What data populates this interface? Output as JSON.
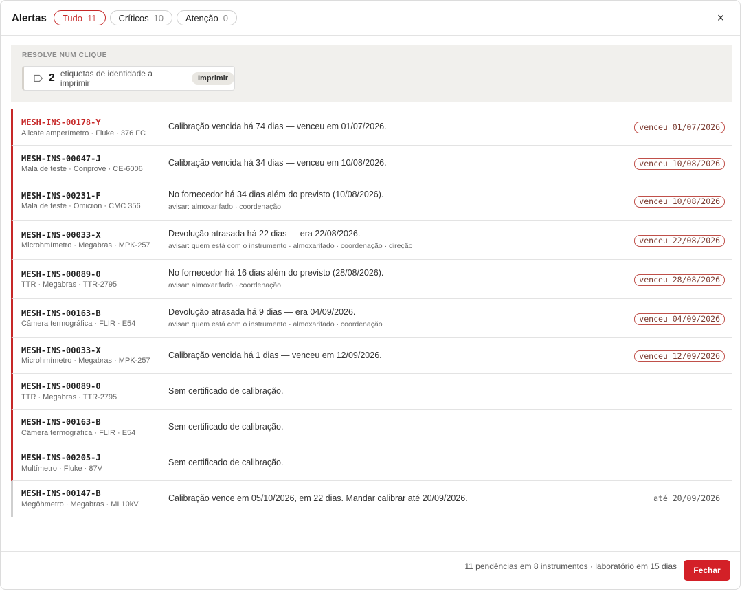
{
  "header": {
    "title": "Alertas",
    "tabs": [
      {
        "label": "Tudo",
        "count": "11",
        "active": true
      },
      {
        "label": "Críticos",
        "count": "10",
        "active": false
      },
      {
        "label": "Atenção",
        "count": "0",
        "active": false
      }
    ],
    "close": "×"
  },
  "quick": {
    "title": "RESOLVE NUM CLIQUE",
    "count": "2",
    "text": "etiquetas de identidade a imprimir",
    "button": "Imprimir"
  },
  "rows": [
    {
      "code": "MESH-INS-00178-Y",
      "sub": "Alicate amperímetro · Fluke · 376 FC",
      "msg": "Calibração vencida há 74 dias — venceu em 01/07/2026.",
      "note": "",
      "badge": "venceu 01/07/2026"
    },
    {
      "code": "MESH-INS-00047-J",
      "sub": "Mala de teste · Conprove · CE-6006",
      "msg": "Calibração vencida há 34 dias — venceu em 10/08/2026.",
      "note": "",
      "badge": "venceu 10/08/2026"
    },
    {
      "code": "MESH-INS-00231-F",
      "sub": "Mala de teste · Omicron · CMC 356",
      "msg": "No fornecedor há 34 dias além do previsto (10/08/2026).",
      "note": "avisar: almoxarifado · coordenação",
      "badge": "venceu 10/08/2026"
    },
    {
      "code": "MESH-INS-00033-X",
      "sub": "Microhmímetro · Megabras · MPK-257",
      "msg": "Devolução atrasada há 22 dias — era 22/08/2026.",
      "note": "avisar: quem está com o instrumento · almoxarifado · coordenação · direção",
      "badge": "venceu 22/08/2026"
    },
    {
      "code": "MESH-INS-00089-0",
      "sub": "TTR · Megabras · TTR-2795",
      "msg": "No fornecedor há 16 dias além do previsto (28/08/2026).",
      "note": "avisar: almoxarifado · coordenação",
      "badge": "venceu 28/08/2026"
    },
    {
      "code": "MESH-INS-00163-B",
      "sub": "Câmera termográfica · FLIR · E54",
      "msg": "Devolução atrasada há 9 dias — era 04/09/2026.",
      "note": "avisar: quem está com o instrumento · almoxarifado · coordenação",
      "badge": "venceu 04/09/2026"
    },
    {
      "code": "MESH-INS-00033-X",
      "sub": "Microhmímetro · Megabras · MPK-257",
      "msg": "Calibração vencida há 1 dias — venceu em 12/09/2026.",
      "note": "",
      "badge": "venceu 12/09/2026"
    },
    {
      "code": "MESH-INS-00089-0",
      "sub": "TTR · Megabras · TTR-2795",
      "msg": "Sem certificado de calibração.",
      "note": "",
      "badge": ""
    },
    {
      "code": "MESH-INS-00163-B",
      "sub": "Câmera termográfica · FLIR · E54",
      "msg": "Sem certificado de calibração.",
      "note": "",
      "badge": ""
    },
    {
      "code": "MESH-INS-00205-J",
      "sub": "Multímetro · Fluke · 87V",
      "msg": "Sem certificado de calibração.",
      "note": "",
      "badge": ""
    },
    {
      "code": "MESH-INS-00147-B",
      "sub": "Megôhmetro · Megabras · MI 10kV",
      "msg": "Calibração vence em 05/10/2026, em 22 dias. Mandar calibrar até 20/09/2026.",
      "note": "",
      "badge": "até 20/09/2026"
    }
  ],
  "footer": {
    "summary": "11 pendências em 8 instrumentos · laboratório em 15 dias",
    "button": "Fechar"
  },
  "colors": {
    "accent": "#c62828",
    "button": "#d32027"
  }
}
